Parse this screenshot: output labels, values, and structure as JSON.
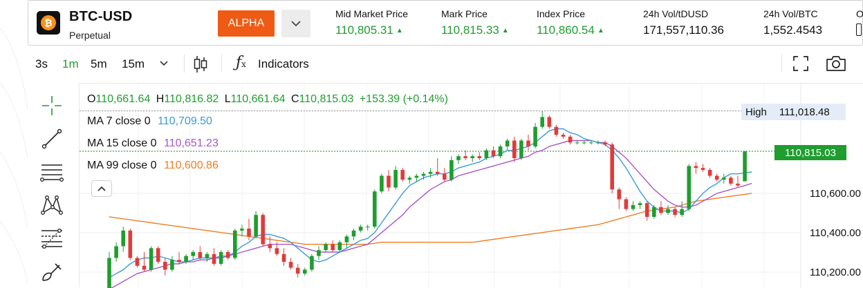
{
  "header": {
    "symbol": "BTC-USD",
    "contract_type": "Perpetual",
    "coin_icon": "bitcoin-icon",
    "badge": "ALPHA",
    "stats": [
      {
        "label": "Mid Market Price",
        "value": "110,805.31",
        "trend": "up"
      },
      {
        "label": "Mark Price",
        "value": "110,815.33",
        "trend": "up"
      },
      {
        "label": "Index Price",
        "value": "110,860.54",
        "trend": "up"
      },
      {
        "label": "24h Vol/tDUSD",
        "value": "171,557,110.36"
      },
      {
        "label": "24h Vol/BTC",
        "value": "1,552.4543"
      },
      {
        "label": "O"
      }
    ]
  },
  "toolbar": {
    "timeframes": [
      "3s",
      "1m",
      "5m",
      "15m"
    ],
    "active_timeframe": "1m",
    "indicators_label": "Indicators",
    "icons": [
      "chevron-down-icon",
      "candlestick-icon",
      "fx-icon",
      "fullscreen-icon",
      "camera-icon"
    ]
  },
  "legend": {
    "open_prefix": "O",
    "open": "110,661.64",
    "high_prefix": "H",
    "high": "110,816.82",
    "low_prefix": "L",
    "low": "110,661.64",
    "close_prefix": "C",
    "close": "110,815.03",
    "change": "+153.39 (+0.14%)",
    "ma7_label": "MA 7 close 0",
    "ma7_value": "110,709.50",
    "ma15_label": "MA 15 close 0",
    "ma15_value": "110,651.23",
    "ma99_label": "MA 99 close 0",
    "ma99_value": "110,600.86"
  },
  "price_axis": {
    "high_label": "High",
    "high_value": "111,018.48",
    "last_price": "110,815.03",
    "ticks": [
      "110,600.00",
      "110,400.00",
      "110,200.00"
    ]
  },
  "colors": {
    "up": "#1f9d2f",
    "down": "#e03b3b",
    "accent": "#ef5a14",
    "ma7": "#3a9ad9",
    "ma15": "#a855c9",
    "ma99": "#ef7d22"
  },
  "chart_data": {
    "type": "candlestick",
    "ylim": [
      110150,
      111100
    ],
    "candles": [
      {
        "o": 110060,
        "h": 110300,
        "l": 110040,
        "c": 110270
      },
      {
        "o": 110270,
        "h": 110350,
        "l": 110250,
        "c": 110330
      },
      {
        "o": 110330,
        "h": 110430,
        "l": 110300,
        "c": 110410
      },
      {
        "o": 110410,
        "h": 110420,
        "l": 110260,
        "c": 110270
      },
      {
        "o": 110270,
        "h": 110280,
        "l": 110220,
        "c": 110230
      },
      {
        "o": 110230,
        "h": 110300,
        "l": 110200,
        "c": 110210
      },
      {
        "o": 110210,
        "h": 110330,
        "l": 110200,
        "c": 110320
      },
      {
        "o": 110320,
        "h": 110330,
        "l": 110240,
        "c": 110250
      },
      {
        "o": 110250,
        "h": 110270,
        "l": 110180,
        "c": 110210
      },
      {
        "o": 110210,
        "h": 110280,
        "l": 110200,
        "c": 110260
      },
      {
        "o": 110260,
        "h": 110300,
        "l": 110240,
        "c": 110250
      },
      {
        "o": 110250,
        "h": 110290,
        "l": 110240,
        "c": 110280
      },
      {
        "o": 110280,
        "h": 110310,
        "l": 110260,
        "c": 110300
      },
      {
        "o": 110300,
        "h": 110330,
        "l": 110260,
        "c": 110270
      },
      {
        "o": 110270,
        "h": 110300,
        "l": 110250,
        "c": 110290
      },
      {
        "o": 110290,
        "h": 110320,
        "l": 110230,
        "c": 110240
      },
      {
        "o": 110240,
        "h": 110310,
        "l": 110230,
        "c": 110300
      },
      {
        "o": 110300,
        "h": 110310,
        "l": 110260,
        "c": 110270
      },
      {
        "o": 110270,
        "h": 110420,
        "l": 110260,
        "c": 110410
      },
      {
        "o": 110410,
        "h": 110440,
        "l": 110380,
        "c": 110420
      },
      {
        "o": 110420,
        "h": 110470,
        "l": 110360,
        "c": 110380
      },
      {
        "o": 110380,
        "h": 110510,
        "l": 110370,
        "c": 110490
      },
      {
        "o": 110490,
        "h": 110500,
        "l": 110330,
        "c": 110340
      },
      {
        "o": 110340,
        "h": 110380,
        "l": 110300,
        "c": 110320
      },
      {
        "o": 110320,
        "h": 110350,
        "l": 110280,
        "c": 110290
      },
      {
        "o": 110290,
        "h": 110320,
        "l": 110230,
        "c": 110250
      },
      {
        "o": 110250,
        "h": 110270,
        "l": 110210,
        "c": 110220
      },
      {
        "o": 110220,
        "h": 110240,
        "l": 110170,
        "c": 110190
      },
      {
        "o": 110190,
        "h": 110220,
        "l": 110180,
        "c": 110210
      },
      {
        "o": 110210,
        "h": 110290,
        "l": 110200,
        "c": 110280
      },
      {
        "o": 110280,
        "h": 110330,
        "l": 110260,
        "c": 110310
      },
      {
        "o": 110310,
        "h": 110350,
        "l": 110300,
        "c": 110340
      },
      {
        "o": 110340,
        "h": 110360,
        "l": 110300,
        "c": 110310
      },
      {
        "o": 110310,
        "h": 110360,
        "l": 110300,
        "c": 110350
      },
      {
        "o": 110350,
        "h": 110390,
        "l": 110320,
        "c": 110380
      },
      {
        "o": 110380,
        "h": 110420,
        "l": 110360,
        "c": 110410
      },
      {
        "o": 110410,
        "h": 110440,
        "l": 110400,
        "c": 110430
      },
      {
        "o": 110430,
        "h": 110440,
        "l": 110410,
        "c": 110430
      },
      {
        "o": 110430,
        "h": 110620,
        "l": 110420,
        "c": 110610
      },
      {
        "o": 110610,
        "h": 110700,
        "l": 110600,
        "c": 110690
      },
      {
        "o": 110690,
        "h": 110720,
        "l": 110610,
        "c": 110630
      },
      {
        "o": 110630,
        "h": 110740,
        "l": 110620,
        "c": 110720
      },
      {
        "o": 110720,
        "h": 110730,
        "l": 110660,
        "c": 110670
      },
      {
        "o": 110670,
        "h": 110690,
        "l": 110650,
        "c": 110680
      },
      {
        "o": 110680,
        "h": 110700,
        "l": 110660,
        "c": 110690
      },
      {
        "o": 110690,
        "h": 110710,
        "l": 110670,
        "c": 110700
      },
      {
        "o": 110700,
        "h": 110730,
        "l": 110680,
        "c": 110710
      },
      {
        "o": 110710,
        "h": 110780,
        "l": 110690,
        "c": 110700
      },
      {
        "o": 110700,
        "h": 110730,
        "l": 110660,
        "c": 110670
      },
      {
        "o": 110670,
        "h": 110790,
        "l": 110660,
        "c": 110770
      },
      {
        "o": 110770,
        "h": 110800,
        "l": 110750,
        "c": 110790
      },
      {
        "o": 110790,
        "h": 110820,
        "l": 110770,
        "c": 110780
      },
      {
        "o": 110780,
        "h": 110800,
        "l": 110760,
        "c": 110790
      },
      {
        "o": 110790,
        "h": 110810,
        "l": 110770,
        "c": 110780
      },
      {
        "o": 110780,
        "h": 110830,
        "l": 110770,
        "c": 110820
      },
      {
        "o": 110820,
        "h": 110840,
        "l": 110780,
        "c": 110790
      },
      {
        "o": 110790,
        "h": 110850,
        "l": 110780,
        "c": 110840
      },
      {
        "o": 110840,
        "h": 110880,
        "l": 110820,
        "c": 110870
      },
      {
        "o": 110870,
        "h": 110890,
        "l": 110760,
        "c": 110780
      },
      {
        "o": 110780,
        "h": 110880,
        "l": 110770,
        "c": 110870
      },
      {
        "o": 110870,
        "h": 110900,
        "l": 110820,
        "c": 110840
      },
      {
        "o": 110840,
        "h": 110960,
        "l": 110830,
        "c": 110940
      },
      {
        "o": 110940,
        "h": 111020,
        "l": 110930,
        "c": 110990
      },
      {
        "o": 110990,
        "h": 111000,
        "l": 110930,
        "c": 110940
      },
      {
        "o": 110940,
        "h": 110950,
        "l": 110890,
        "c": 110900
      },
      {
        "o": 110900,
        "h": 110910,
        "l": 110880,
        "c": 110890
      },
      {
        "o": 110890,
        "h": 110900,
        "l": 110850,
        "c": 110860
      },
      {
        "o": 110860,
        "h": 110870,
        "l": 110850,
        "c": 110860
      },
      {
        "o": 110860,
        "h": 110870,
        "l": 110850,
        "c": 110860
      },
      {
        "o": 110860,
        "h": 110870,
        "l": 110850,
        "c": 110860
      },
      {
        "o": 110860,
        "h": 110870,
        "l": 110850,
        "c": 110860
      },
      {
        "o": 110860,
        "h": 110870,
        "l": 110840,
        "c": 110850
      },
      {
        "o": 110850,
        "h": 110860,
        "l": 110600,
        "c": 110620
      },
      {
        "o": 110620,
        "h": 110630,
        "l": 110520,
        "c": 110570
      },
      {
        "o": 110570,
        "h": 110580,
        "l": 110510,
        "c": 110520
      },
      {
        "o": 110520,
        "h": 110560,
        "l": 110510,
        "c": 110540
      },
      {
        "o": 110540,
        "h": 110560,
        "l": 110520,
        "c": 110550
      },
      {
        "o": 110550,
        "h": 110560,
        "l": 110460,
        "c": 110480
      },
      {
        "o": 110480,
        "h": 110540,
        "l": 110470,
        "c": 110530
      },
      {
        "o": 110530,
        "h": 110560,
        "l": 110490,
        "c": 110500
      },
      {
        "o": 110500,
        "h": 110540,
        "l": 110490,
        "c": 110520
      },
      {
        "o": 110520,
        "h": 110530,
        "l": 110480,
        "c": 110490
      },
      {
        "o": 110490,
        "h": 110560,
        "l": 110480,
        "c": 110520
      },
      {
        "o": 110520,
        "h": 110750,
        "l": 110510,
        "c": 110740
      },
      {
        "o": 110740,
        "h": 110760,
        "l": 110700,
        "c": 110730
      },
      {
        "o": 110730,
        "h": 110750,
        "l": 110710,
        "c": 110720
      },
      {
        "o": 110720,
        "h": 110730,
        "l": 110680,
        "c": 110690
      },
      {
        "o": 110690,
        "h": 110700,
        "l": 110660,
        "c": 110670
      },
      {
        "o": 110670,
        "h": 110700,
        "l": 110650,
        "c": 110680
      },
      {
        "o": 110680,
        "h": 110690,
        "l": 110640,
        "c": 110650
      },
      {
        "o": 110650,
        "h": 110690,
        "l": 110630,
        "c": 110640
      },
      {
        "o": 110661.64,
        "h": 110816.82,
        "l": 110661.64,
        "c": 110815.03
      }
    ],
    "ma7": [
      110170,
      110190,
      110210,
      110240,
      110260,
      110270,
      110270,
      110280,
      110270,
      110260,
      110250,
      110250,
      110260,
      110270,
      110270,
      110270,
      110280,
      110280,
      110300,
      110330,
      110350,
      110380,
      110390,
      110390,
      110380,
      110370,
      110350,
      110320,
      110290,
      110260,
      110250,
      110260,
      110280,
      110300,
      110320,
      110340,
      110360,
      110370,
      110400,
      110450,
      110500,
      110550,
      110600,
      110640,
      110660,
      110680,
      110690,
      110700,
      110700,
      110710,
      110730,
      110740,
      110750,
      110760,
      110780,
      110790,
      110800,
      110820,
      110820,
      110830,
      110840,
      110860,
      110890,
      110920,
      110930,
      110930,
      110910,
      110900,
      110880,
      110870,
      110860,
      110850,
      110820,
      110780,
      110730,
      110670,
      110610,
      110560,
      110530,
      110510,
      110510,
      110510,
      110500,
      110520,
      110560,
      110600,
      110630,
      110650,
      110680,
      110700,
      110700,
      110705,
      110709.5
    ],
    "ma15": [
      110110,
      110130,
      110150,
      110170,
      110190,
      110200,
      110210,
      110220,
      110230,
      110240,
      110240,
      110250,
      110250,
      110260,
      110260,
      110270,
      110270,
      110280,
      110290,
      110300,
      110310,
      110320,
      110330,
      110340,
      110340,
      110340,
      110340,
      110330,
      110320,
      110310,
      110300,
      110300,
      110300,
      110300,
      110310,
      110320,
      110330,
      110340,
      110370,
      110400,
      110430,
      110460,
      110490,
      110530,
      110560,
      110590,
      110620,
      110640,
      110660,
      110670,
      110690,
      110700,
      110710,
      110720,
      110730,
      110740,
      110750,
      110760,
      110770,
      110780,
      110790,
      110810,
      110820,
      110840,
      110850,
      110860,
      110870,
      110870,
      110870,
      110870,
      110860,
      110860,
      110840,
      110810,
      110780,
      110740,
      110700,
      110660,
      110620,
      110590,
      110560,
      110540,
      110530,
      110530,
      110540,
      110560,
      110580,
      110600,
      110610,
      110620,
      110630,
      110640,
      110651.23
    ],
    "ma99": [
      110480,
      110475,
      110470,
      110465,
      110460,
      110455,
      110450,
      110445,
      110440,
      110435,
      110430,
      110425,
      110420,
      110415,
      110410,
      110405,
      110400,
      110395,
      110390,
      110385,
      110380,
      110375,
      110370,
      110365,
      110360,
      110355,
      110350,
      110345,
      110340,
      110340,
      110340,
      110340,
      110340,
      110340,
      110340,
      110340,
      110340,
      110340,
      110345,
      110350,
      110350,
      110350,
      110350,
      110350,
      110350,
      110350,
      110350,
      110350,
      110350,
      110350,
      110350,
      110350,
      110350,
      110355,
      110360,
      110365,
      110370,
      110375,
      110380,
      110385,
      110390,
      110395,
      110400,
      110405,
      110410,
      110415,
      110420,
      110425,
      110430,
      110435,
      110440,
      110450,
      110460,
      110470,
      110480,
      110490,
      110500,
      110510,
      110515,
      110520,
      110525,
      110530,
      110540,
      110550,
      110560,
      110565,
      110570,
      110575,
      110580,
      110585,
      110590,
      110595,
      110600.86
    ]
  }
}
